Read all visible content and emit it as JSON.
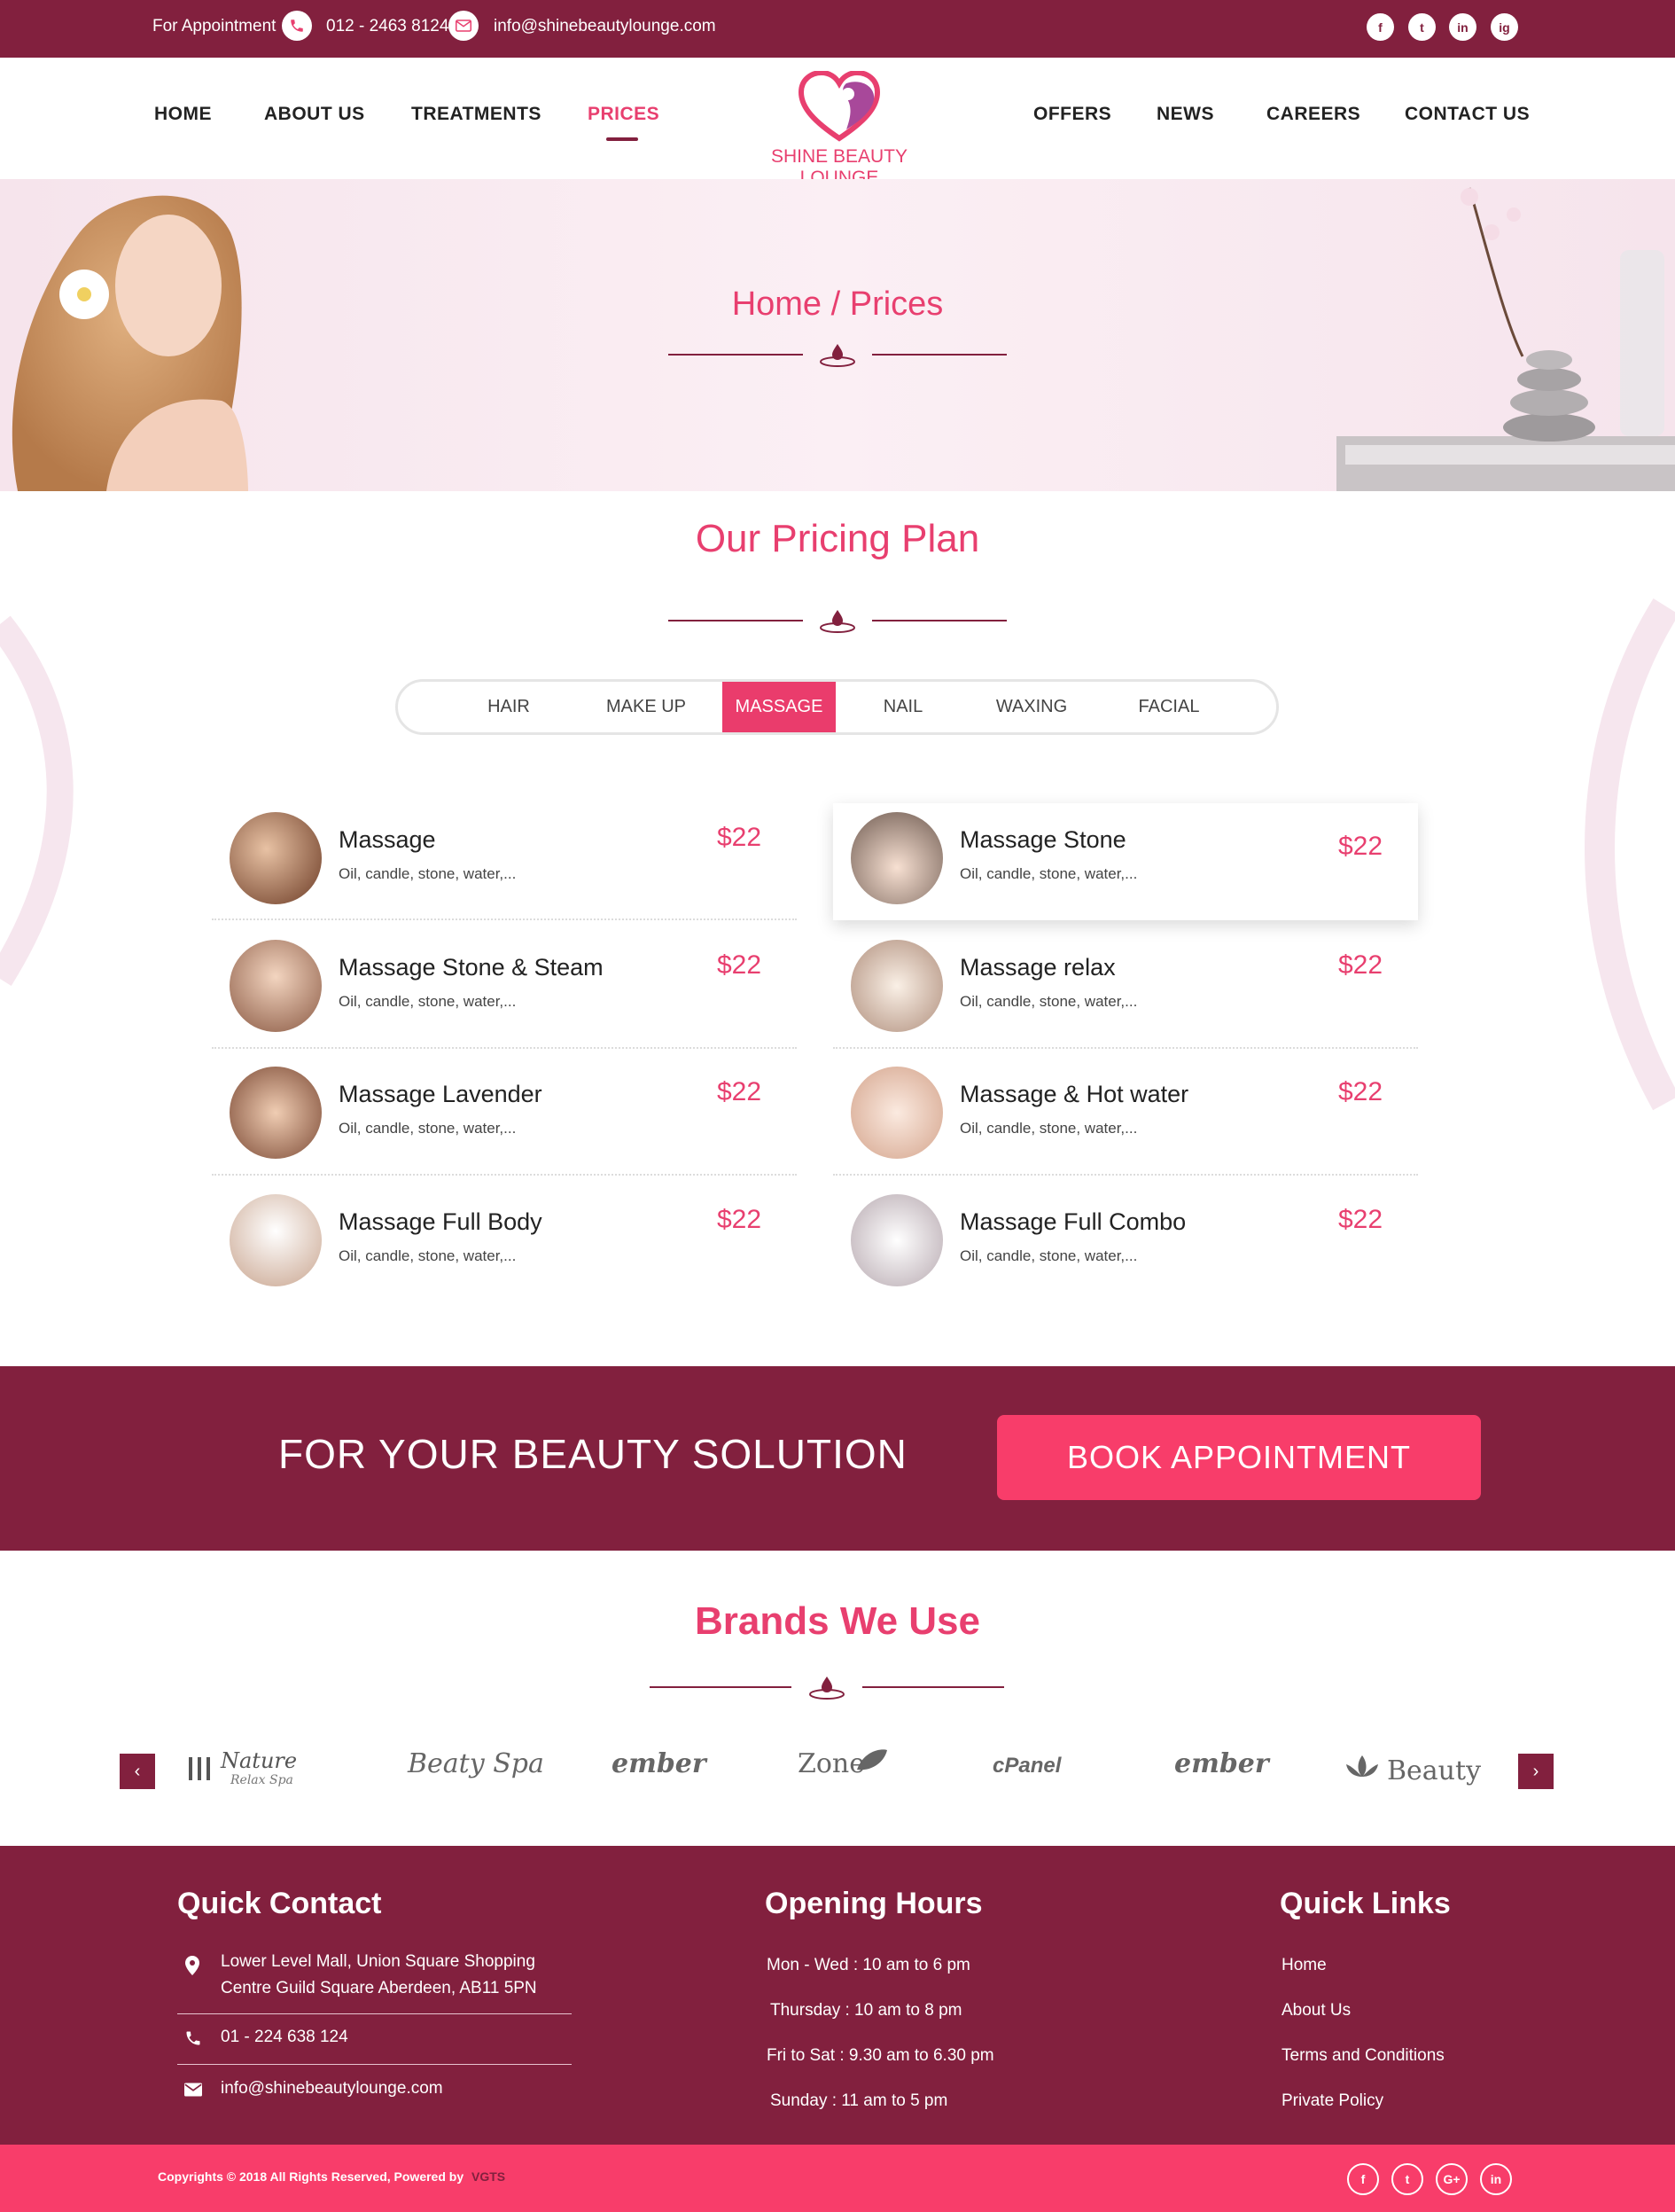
{
  "topbar": {
    "appointment_label": "For Appointment",
    "phone": "012 - 2463 8124",
    "email": "info@shinebeautylounge.com",
    "social": [
      "f",
      "t",
      "in",
      "ig"
    ]
  },
  "nav": {
    "items": [
      "HOME",
      "ABOUT US",
      "TREATMENTS",
      "PRICES",
      "OFFERS",
      "NEWS",
      "CAREERS",
      "CONTACT US"
    ],
    "active": "PRICES"
  },
  "logo": {
    "text": "SHINE BEAUTY LOUNGE"
  },
  "banner": {
    "breadcrumb": "Home / Prices"
  },
  "pricing": {
    "title": "Our Pricing Plan",
    "tabs": [
      "HAIR",
      "MAKE UP",
      "MASSAGE",
      "NAIL",
      "WAXING",
      "FACIAL"
    ],
    "active_tab": "MASSAGE",
    "items": [
      {
        "name": "Massage",
        "desc": "Oil, candle, stone, water,...",
        "price": "$22"
      },
      {
        "name": "Massage Stone",
        "desc": "Oil, candle, stone, water,...",
        "price": "$22"
      },
      {
        "name": "Massage Stone & Steam",
        "desc": "Oil, candle, stone, water,...",
        "price": "$22"
      },
      {
        "name": "Massage relax",
        "desc": "Oil, candle, stone, water,...",
        "price": "$22"
      },
      {
        "name": "Massage Lavender",
        "desc": "Oil, candle, stone, water,...",
        "price": "$22"
      },
      {
        "name": "Massage & Hot water",
        "desc": "Oil, candle, stone, water,...",
        "price": "$22"
      },
      {
        "name": "Massage Full Body",
        "desc": "Oil, candle, stone, water,...",
        "price": "$22"
      },
      {
        "name": "Massage Full Combo",
        "desc": "Oil, candle, stone, water,...",
        "price": "$22"
      }
    ]
  },
  "cta": {
    "text": "FOR YOUR BEAUTY SOLUTION",
    "button": "BOOK APPOINTMENT"
  },
  "brands": {
    "title": "Brands We Use",
    "logos": [
      "Nature",
      "Relax Spa",
      "Beaty Spa",
      "ember",
      "Zone",
      "cPanel",
      "ember",
      "Beauty"
    ],
    "prev": "‹",
    "next": "›"
  },
  "footer": {
    "quick_contact": {
      "title": "Quick Contact",
      "address_line1": "Lower Level Mall, Union Square Shopping",
      "address_line2": "Centre Guild Square Aberdeen, AB11 5PN",
      "phone": "01 - 224 638 124",
      "email": "info@shinebeautylounge.com"
    },
    "opening_hours": {
      "title": "Opening Hours",
      "lines": [
        "Mon - Wed : 10 am to 6 pm",
        "Thursday : 10 am  to 8 pm",
        "Fri to Sat : 9.30 am  to 6.30 pm",
        "Sunday : 11 am to 5 pm"
      ]
    },
    "quick_links": {
      "title": "Quick Links",
      "links": [
        "Home",
        "About Us",
        "Terms and Conditions",
        "Private Policy"
      ]
    },
    "copyright": "Copyrights © 2018 All Rights Reserved, Powered by",
    "powered_by": "VGTS",
    "social": [
      "f",
      "t",
      "G+",
      "in"
    ]
  },
  "colors": {
    "primary": "#82203e",
    "accent": "#e83f6f",
    "button": "#f83d6a"
  }
}
